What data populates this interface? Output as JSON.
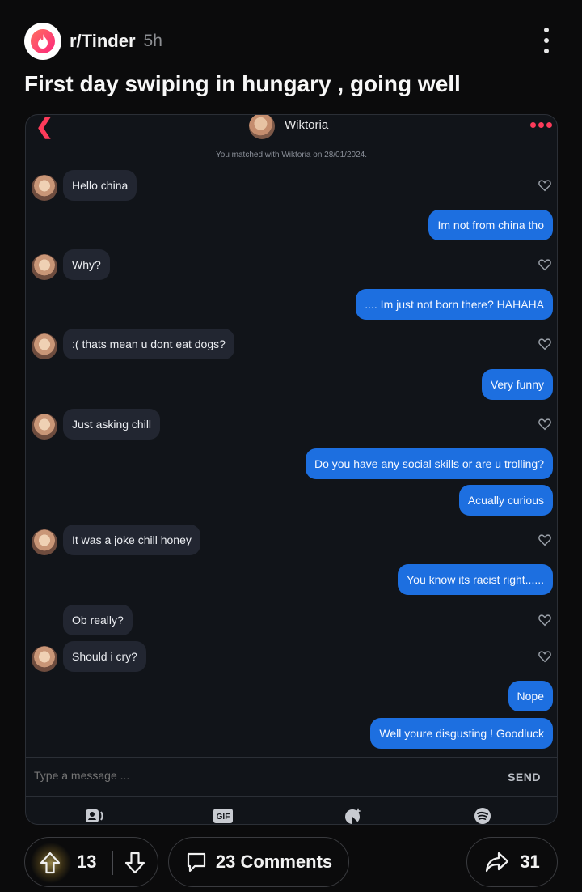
{
  "post": {
    "subreddit": "r/Tinder",
    "age": "5h",
    "title": "First day swiping in hungary , going well"
  },
  "chat": {
    "match_name": "Wiktoria",
    "match_note": "You matched with Wiktoria on 28/01/2024.",
    "messages": [
      {
        "from": "them",
        "text": "Hello china"
      },
      {
        "from": "me",
        "text": "Im not from china tho"
      },
      {
        "from": "them",
        "text": "Why?"
      },
      {
        "from": "me",
        "text": ".... Im just not born there? HAHAHA"
      },
      {
        "from": "them",
        "text": ":( thats mean u dont eat dogs?"
      },
      {
        "from": "me",
        "text": "Very funny"
      },
      {
        "from": "them",
        "text": "Just asking chill"
      },
      {
        "from": "me",
        "text": "Do you have any social skills or are u trolling?"
      },
      {
        "from": "me",
        "text": "Acually curious"
      },
      {
        "from": "them",
        "text": "It was a joke chill honey"
      },
      {
        "from": "me",
        "text": "You know its racist right......"
      },
      {
        "from": "them",
        "text": "Ob really?"
      },
      {
        "from": "them",
        "text": "Should i cry?"
      },
      {
        "from": "me",
        "text": "Nope"
      },
      {
        "from": "me",
        "text": "Well youre disgusting ! Goodluck"
      }
    ],
    "composer_placeholder": "Type a message ...",
    "send_label": "SEND",
    "toolbar": {
      "gif_label": "GIF"
    }
  },
  "actions": {
    "vote_count": "13",
    "comments_label": "23 Comments",
    "share_count": "31"
  },
  "colors": {
    "tinder_accent": "#fd3b5a",
    "outgoing_bubble": "#1d6fe0",
    "incoming_bubble": "#222631",
    "background": "#0b0b0c"
  }
}
